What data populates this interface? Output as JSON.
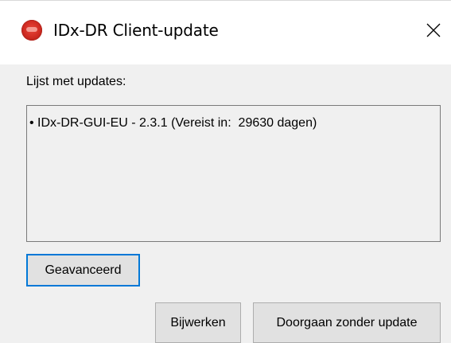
{
  "window": {
    "title": "IDx-DR Client-update",
    "icon": "app-icon-red-circle",
    "close_icon": "close-icon"
  },
  "updates": {
    "label": "Lijst met updates:",
    "items": [
      "• IDx-DR-GUI-EU - 2.3.1 (Vereist in:  29630 dagen)"
    ]
  },
  "buttons": {
    "advanced": "Geavanceerd",
    "update": "Bijwerken",
    "continue_without_update": "Doorgaan zonder update"
  },
  "colors": {
    "focus_border": "#0078d7",
    "button_face": "#e1e1e1",
    "dialog_background": "#f0f0f0",
    "icon_red": "#cf2a21"
  }
}
